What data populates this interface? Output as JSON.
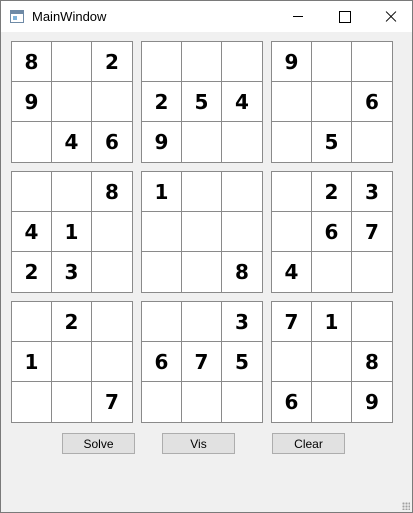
{
  "window": {
    "title": "MainWindow",
    "icon": "app-window-icon"
  },
  "blocks": [
    {
      "id": "b0",
      "cells": [
        "8",
        "",
        "2",
        "9",
        "",
        "",
        "",
        "4",
        "6"
      ]
    },
    {
      "id": "b1",
      "cells": [
        "",
        "",
        "",
        "2",
        "5",
        "4",
        "9",
        "",
        ""
      ]
    },
    {
      "id": "b2",
      "cells": [
        "9",
        "",
        "",
        "",
        "",
        "6",
        "",
        "5",
        ""
      ]
    },
    {
      "id": "b3",
      "cells": [
        "",
        "",
        "8",
        "4",
        "1",
        "",
        "2",
        "3",
        ""
      ]
    },
    {
      "id": "b4",
      "cells": [
        "1",
        "",
        "",
        "",
        "",
        "",
        "",
        "",
        "8"
      ]
    },
    {
      "id": "b5",
      "cells": [
        "",
        "2",
        "3",
        "",
        "6",
        "7",
        "4",
        "",
        ""
      ]
    },
    {
      "id": "b6",
      "cells": [
        "",
        "2",
        "",
        "1",
        "",
        "",
        "",
        "",
        "7"
      ]
    },
    {
      "id": "b7",
      "cells": [
        "",
        "",
        "3",
        "6",
        "7",
        "5",
        "",
        "",
        ""
      ]
    },
    {
      "id": "b8",
      "cells": [
        "7",
        "1",
        "",
        "",
        "",
        "8",
        "6",
        "",
        "9"
      ]
    }
  ],
  "buttons": {
    "solve": "Solve",
    "vis": "Vis",
    "clear": "Clear"
  }
}
